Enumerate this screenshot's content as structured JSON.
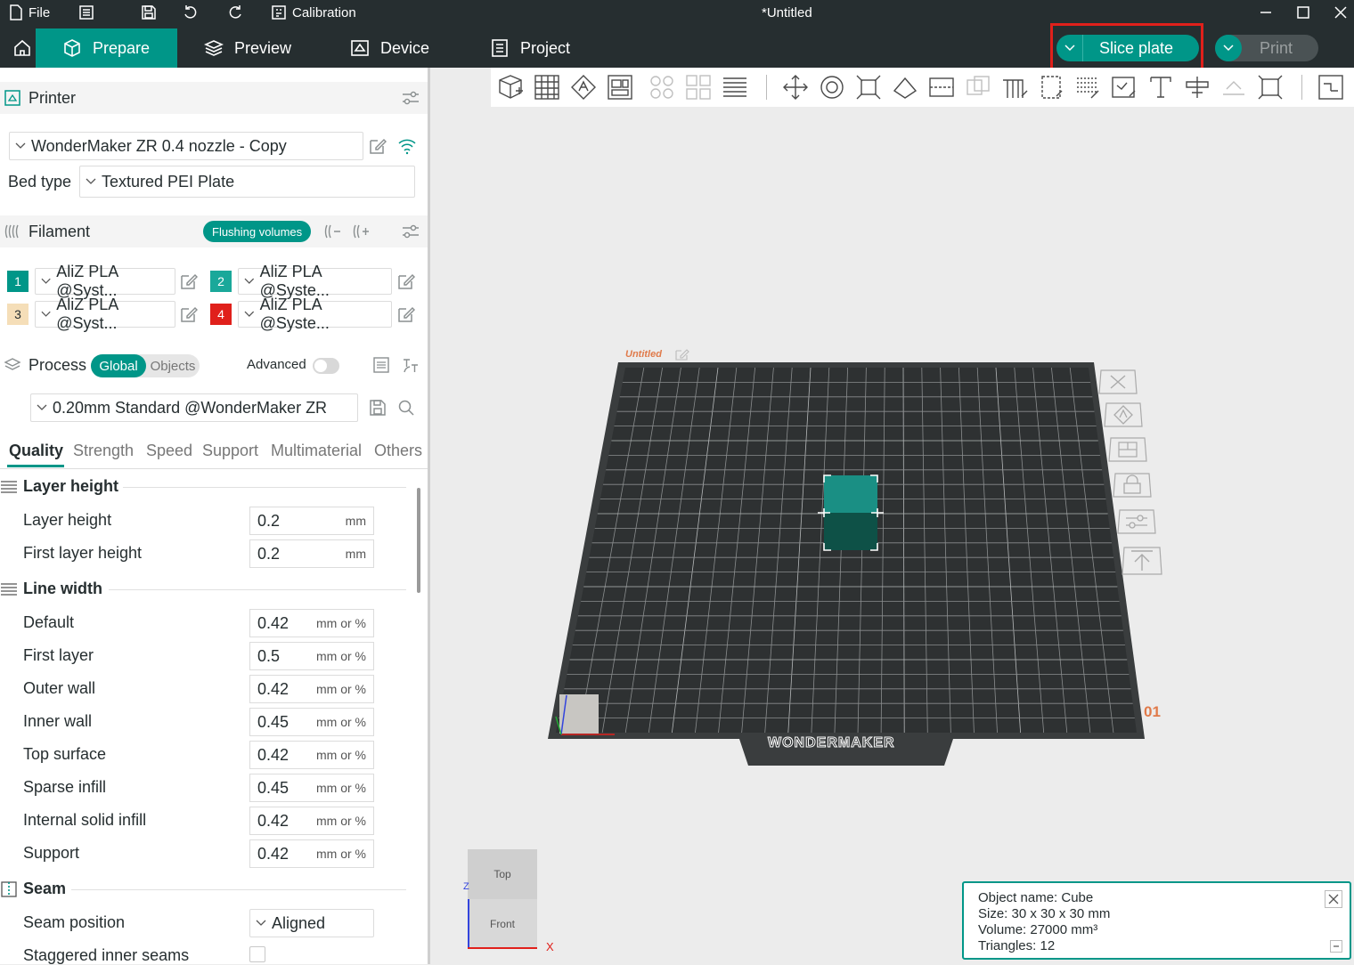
{
  "titlebar": {
    "file_label": "File",
    "calibration_label": "Calibration",
    "window_title": "*Untitled"
  },
  "tabs": [
    {
      "label": "Prepare"
    },
    {
      "label": "Preview"
    },
    {
      "label": "Device"
    },
    {
      "label": "Project"
    }
  ],
  "actions": {
    "slice_label": "Slice plate",
    "print_label": "Print"
  },
  "printer": {
    "section_label": "Printer",
    "printer_name": "WonderMaker ZR 0.4 nozzle - Copy",
    "bed_type_label": "Bed type",
    "bed_type_value": "Textured PEI Plate"
  },
  "filament": {
    "section_label": "Filament",
    "flushing_label": "Flushing volumes",
    "slots": [
      {
        "num": "1",
        "name": "AliZ PLA @Syst...",
        "color": "#009688",
        "text_color": "#ffffff"
      },
      {
        "num": "2",
        "name": "AliZ PLA @Syste...",
        "color": "#1aa89a",
        "text_color": "#ffffff"
      },
      {
        "num": "3",
        "name": "AliZ PLA @Syst...",
        "color": "#f5deb8",
        "text_color": "#262e30"
      },
      {
        "num": "4",
        "name": "AliZ PLA @Syste...",
        "color": "#e0201b",
        "text_color": "#ffffff"
      }
    ]
  },
  "process": {
    "section_label": "Process",
    "global_label": "Global",
    "objects_label": "Objects",
    "advanced_label": "Advanced",
    "preset": "0.20mm Standard @WonderMaker ZR",
    "subtabs": [
      "Quality",
      "Strength",
      "Speed",
      "Support",
      "Multimaterial",
      "Others"
    ],
    "groups": {
      "layer_height": {
        "title": "Layer height",
        "rows": [
          {
            "label": "Layer height",
            "value": "0.2",
            "unit": "mm"
          },
          {
            "label": "First layer height",
            "value": "0.2",
            "unit": "mm"
          }
        ]
      },
      "line_width": {
        "title": "Line width",
        "rows": [
          {
            "label": "Default",
            "value": "0.42",
            "unit": "mm or %"
          },
          {
            "label": "First layer",
            "value": "0.5",
            "unit": "mm or %"
          },
          {
            "label": "Outer wall",
            "value": "0.42",
            "unit": "mm or %"
          },
          {
            "label": "Inner wall",
            "value": "0.45",
            "unit": "mm or %"
          },
          {
            "label": "Top surface",
            "value": "0.42",
            "unit": "mm or %"
          },
          {
            "label": "Sparse infill",
            "value": "0.45",
            "unit": "mm or %"
          },
          {
            "label": "Internal solid infill",
            "value": "0.42",
            "unit": "mm or %"
          },
          {
            "label": "Support",
            "value": "0.42",
            "unit": "mm or %"
          }
        ]
      },
      "seam": {
        "title": "Seam",
        "seam_position_label": "Seam position",
        "seam_position_value": "Aligned",
        "staggered_label": "Staggered inner seams"
      }
    }
  },
  "plate": {
    "name_label": "Untitled",
    "plate_number": "01",
    "brand": "WONDERMAKER"
  },
  "view_cube": {
    "top_label": "Top",
    "front_label": "Front",
    "axis_z": "Z",
    "axis_x": "X"
  },
  "object_info": {
    "name_line": "Object name: Cube",
    "size_line": "Size: 30 x 30 x 30 mm",
    "volume_line": "Volume: 27000 mm³",
    "triangles_line": "Triangles: 12"
  },
  "colors": {
    "accent": "#009688",
    "dark": "#262e30",
    "highlight": "#e0201b"
  }
}
